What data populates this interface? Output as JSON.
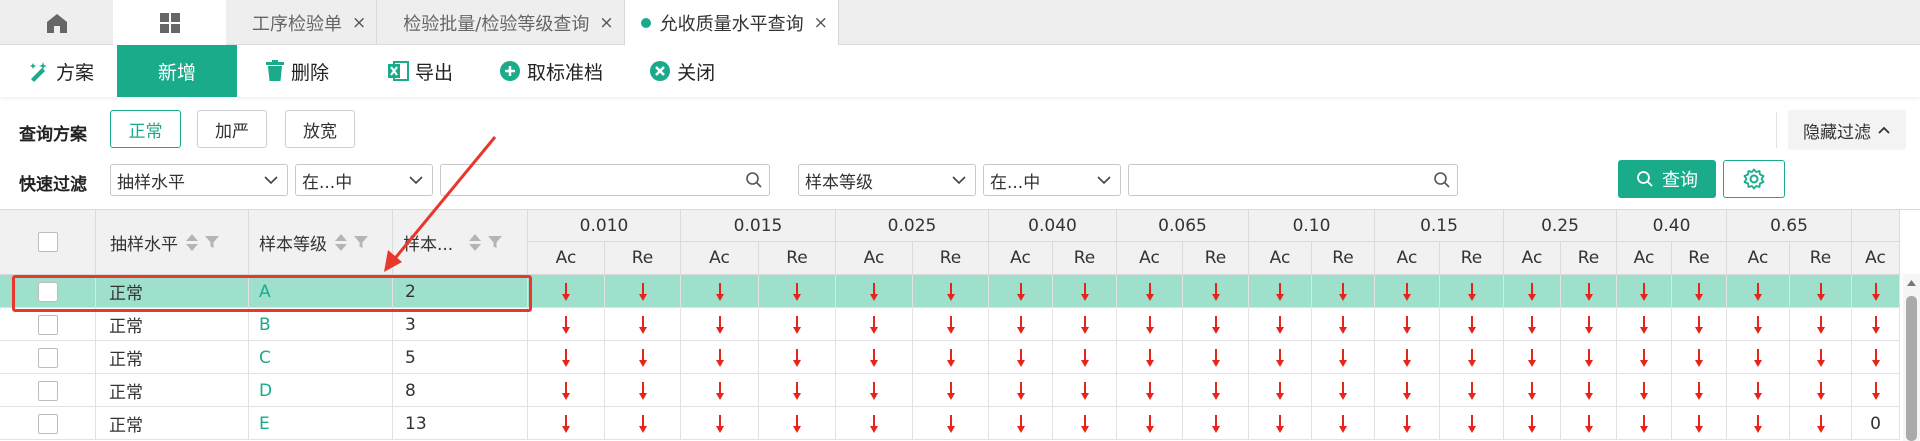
{
  "tabs": {
    "home_icon": "home-icon",
    "grid_icon": "grid-icon",
    "items": [
      {
        "label": "工序检验单",
        "active": false
      },
      {
        "label": "检验批量/检验等级查询",
        "active": false
      },
      {
        "label": "允收质量水平查询",
        "active": true
      }
    ],
    "close_glyph": "×"
  },
  "toolbar": {
    "scheme": "方案",
    "new": "新增",
    "delete": "删除",
    "export": "导出",
    "cancel_standard": "取标准档",
    "close": "关闭"
  },
  "filters": {
    "scheme_label": "查询方案",
    "scheme_options": [
      "正常",
      "加严",
      "放宽"
    ],
    "scheme_selected": "正常",
    "hide_filter": "隐藏过滤",
    "quick_label": "快速过滤",
    "field1": "抽样水平",
    "op1": "在...中",
    "value1": "",
    "field2": "样本等级",
    "op2": "在...中",
    "value2": "",
    "query": "查询"
  },
  "grid": {
    "headers": {
      "sampling_level": "抽样水平",
      "sample_grade": "样本等级",
      "sample_size": "样本..."
    },
    "aql_columns": [
      "0.010",
      "0.015",
      "0.025",
      "0.040",
      "0.065",
      "0.10",
      "0.15",
      "0.25",
      "0.40",
      "0.65"
    ],
    "sub_headers": {
      "ac": "Ac",
      "re": "Re"
    },
    "rows": [
      {
        "level": "正常",
        "grade": "A",
        "size": "2",
        "last": "",
        "highlight": true
      },
      {
        "level": "正常",
        "grade": "B",
        "size": "3",
        "last": "",
        "highlight": false
      },
      {
        "level": "正常",
        "grade": "C",
        "size": "5",
        "last": "",
        "highlight": false
      },
      {
        "level": "正常",
        "grade": "D",
        "size": "8",
        "last": "",
        "highlight": false
      },
      {
        "level": "正常",
        "grade": "E",
        "size": "13",
        "last": "0",
        "highlight": false
      }
    ]
  },
  "colors": {
    "accent": "#1aab8a",
    "highlight_row": "#9fe0cd",
    "annotation": "#e8372c",
    "arrow": "#e8231a"
  }
}
